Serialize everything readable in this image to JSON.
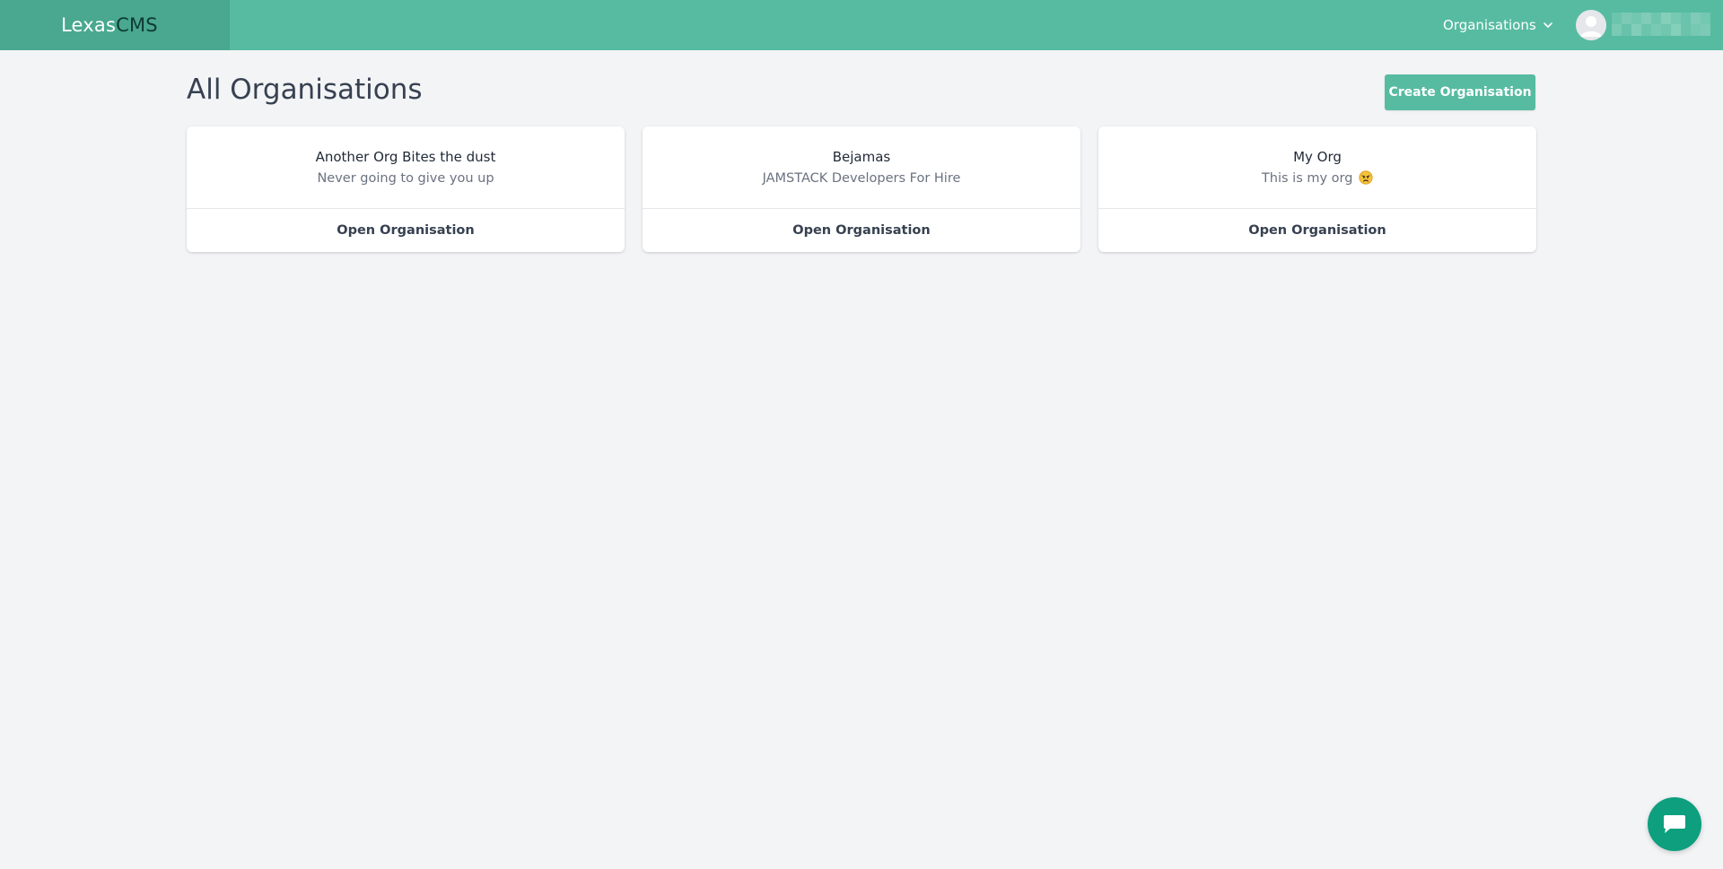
{
  "header": {
    "brand_part1": "Lexas",
    "brand_part2": "CMS",
    "nav_menu_label": "Organisations",
    "user_name_blurred": ""
  },
  "main": {
    "page_title": "All Organisations",
    "create_button_label": "Create Organisation",
    "organisations": [
      {
        "name": "Another Org Bites the dust",
        "description": "Never going to give you up",
        "open_label": "Open Organisation"
      },
      {
        "name": "Bejamas",
        "description": "JAMSTACK Developers For Hire",
        "open_label": "Open Organisation"
      },
      {
        "name": "My Org",
        "description": "This is my org",
        "open_label": "Open Organisation",
        "emoji": "angry-face"
      }
    ]
  },
  "colors": {
    "accent": "#56bba1",
    "brand_bg": "#49a88f",
    "chat_button": "#0e9f7e",
    "page_bg": "#f3f4f6"
  },
  "icons": {
    "nav_chevron": "chevron-down-icon",
    "avatar": "user-avatar-icon",
    "chat": "chat-bubble-icon"
  }
}
